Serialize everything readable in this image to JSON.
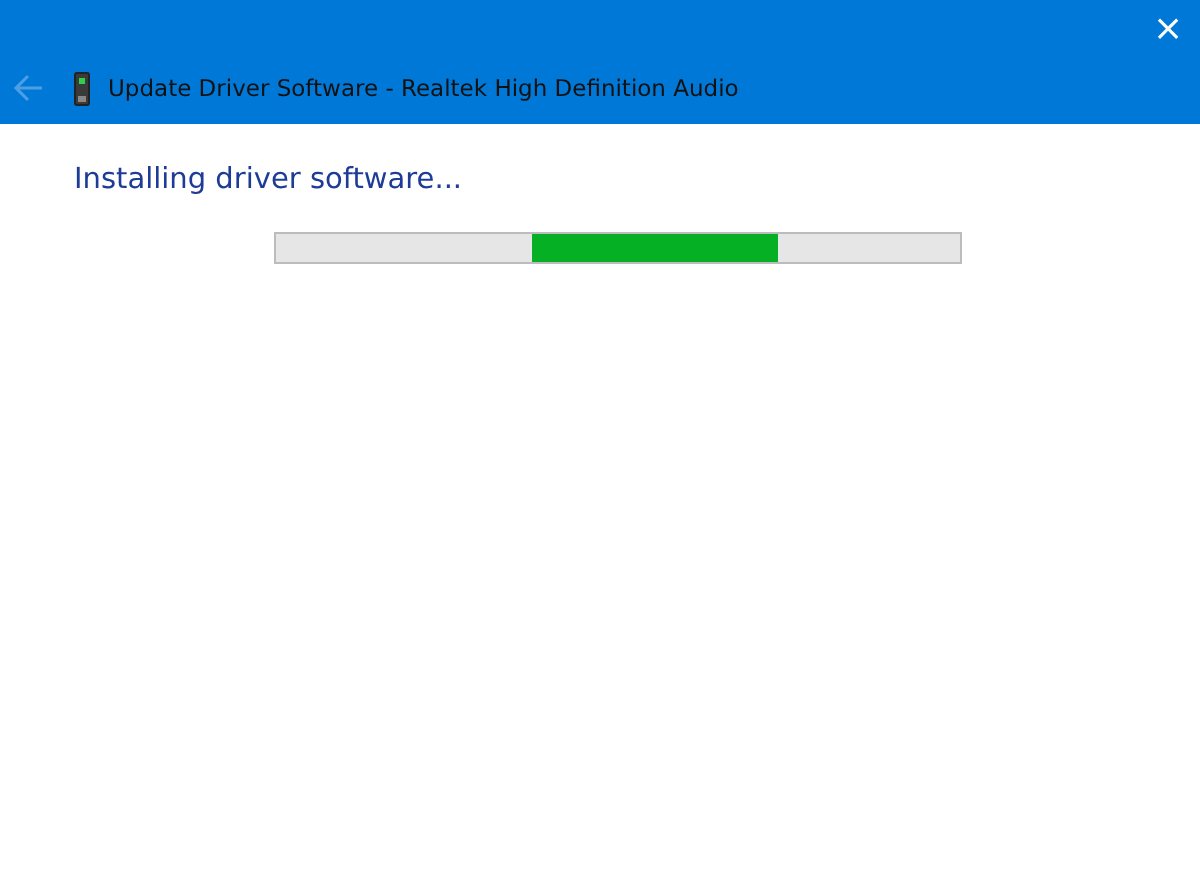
{
  "window": {
    "title": "Update Driver Software - Realtek High Definition Audio",
    "close": "×",
    "back_button": {
      "disabled": true
    }
  },
  "status": "Installing driver software...",
  "progress": {
    "kind": "marquee"
  }
}
